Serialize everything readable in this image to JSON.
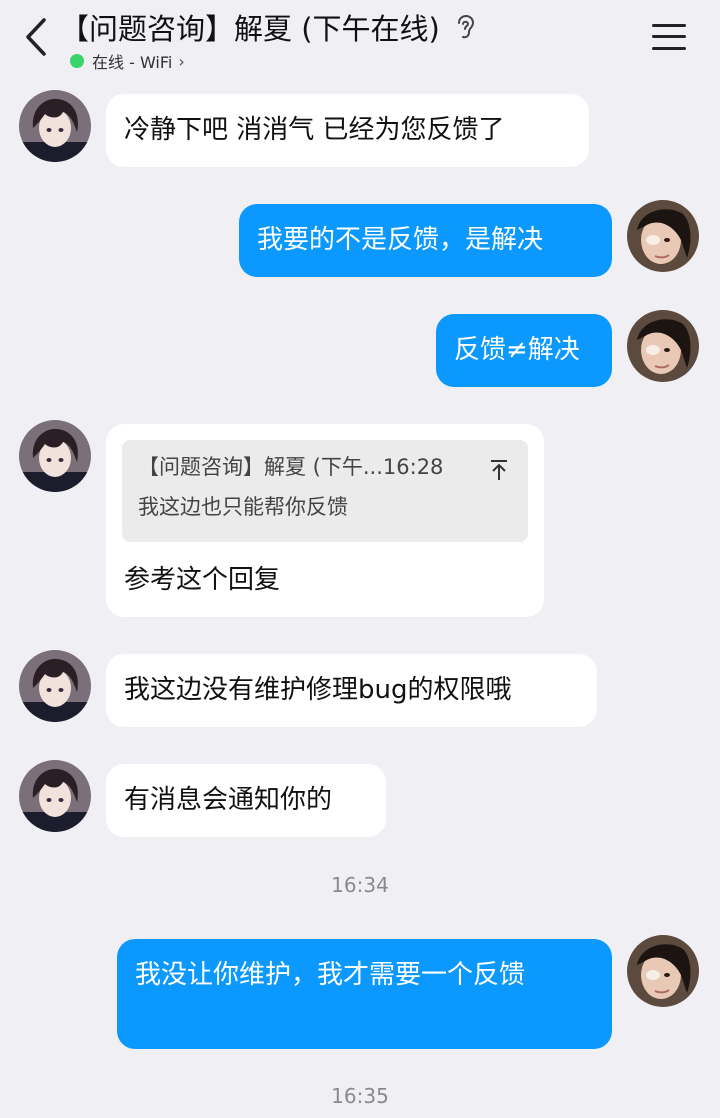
{
  "header": {
    "title": "【问题咨询】解夏 (下午在线)",
    "status": "在线 - WiFi",
    "status_color": "#3ad36a"
  },
  "icons": {
    "back": "chevron-left-icon",
    "ear": "ear-icon",
    "menu": "hamburger-menu-icon"
  },
  "colors": {
    "background": "#efeff4",
    "incoming_bubble": "#ffffff",
    "outgoing_bubble": "#0b99ff"
  },
  "messages": [
    {
      "from": "agent",
      "text": "冷静下吧 消消气 已经为您反馈了"
    },
    {
      "from": "me",
      "text": "我要的不是反馈，是解决"
    },
    {
      "from": "me",
      "text": "反馈≠解决"
    },
    {
      "from": "agent",
      "quote": {
        "header": "【问题咨询】解夏 (下午...16:28",
        "text": "我这边也只能帮你反馈"
      },
      "text": "参考这个回复"
    },
    {
      "from": "agent",
      "text": "我这边没有维护修理bug的权限哦"
    },
    {
      "from": "agent",
      "text": "有消息会通知你的"
    },
    {
      "from": "me",
      "text": "我没让你维护，我才需要一个反馈"
    }
  ],
  "timestamps": [
    "16:34",
    "16:35"
  ]
}
